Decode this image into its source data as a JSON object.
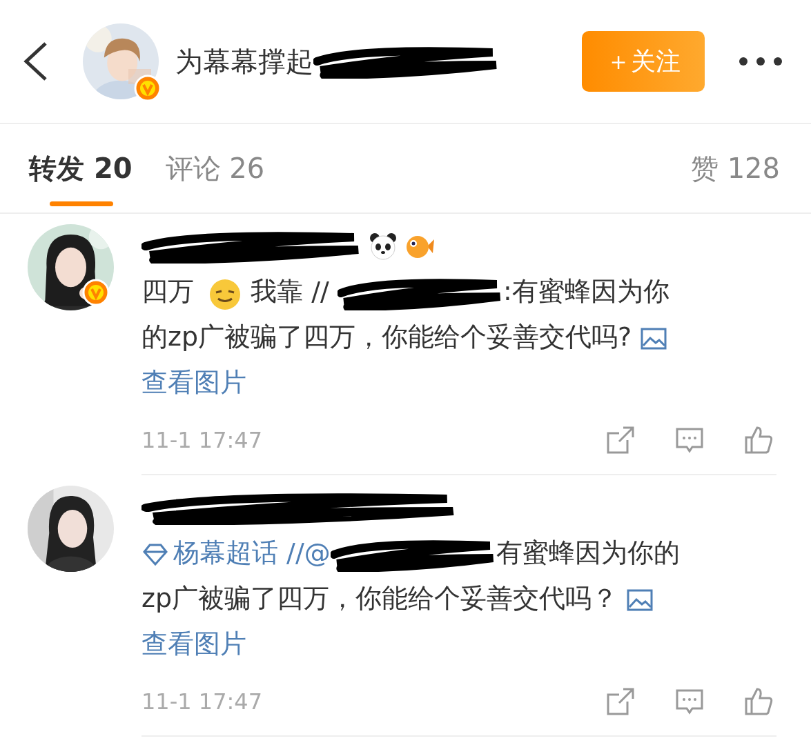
{
  "header": {
    "title": "为幕幕撑起",
    "verified": true,
    "follow_button": "＋关注"
  },
  "tabs": [
    {
      "label": "转发",
      "count": "20",
      "selected": true
    },
    {
      "label": "评论",
      "count": "26",
      "selected": false
    }
  ],
  "likes": {
    "label": "赞",
    "count": "128"
  },
  "reposts": [
    {
      "verified": true,
      "segments": [
        {
          "kind": "text",
          "text": "四万"
        },
        {
          "kind": "emoji"
        },
        {
          "kind": "text",
          "text": "我靠 //"
        },
        {
          "kind": "redacted"
        },
        {
          "kind": "text",
          "text": ":有蜜蜂因为你"
        },
        {
          "kind": "text",
          "text": "的zp广被骗了四万，你能给个妥善交代吗?"
        },
        {
          "kind": "image_link",
          "text": "查看图片"
        }
      ],
      "time": "11-1 17:47"
    },
    {
      "verified": false,
      "segments": [
        {
          "kind": "topic",
          "text": "杨幕超话"
        },
        {
          "kind": "mention",
          "text": "//@"
        },
        {
          "kind": "redacted"
        },
        {
          "kind": "text",
          "text": "有蜜蜂因为你的"
        },
        {
          "kind": "text",
          "text": "zp广被骗了四万，你能给个妥善交代吗？"
        },
        {
          "kind": "image_link",
          "text": "查看图片"
        }
      ],
      "time": "11-1 17:47"
    }
  ]
}
